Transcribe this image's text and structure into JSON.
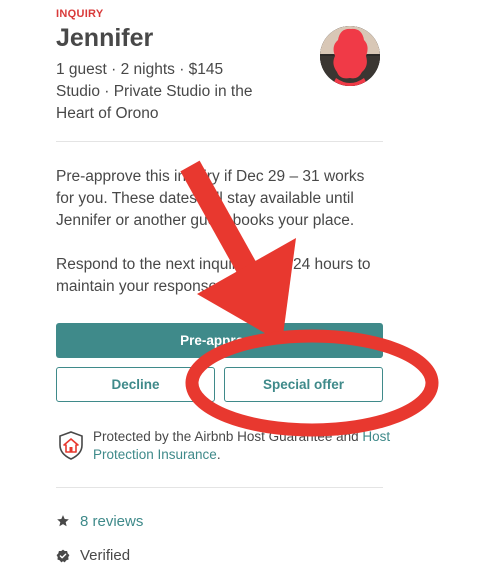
{
  "header": {
    "status_label": "INQUIRY",
    "guest_name": "Jennifer",
    "trip_summary": "1 guest · 2 nights · $145",
    "listing_line1": "Studio · Private Studio in the",
    "listing_line2": "Heart of Orono"
  },
  "message": {
    "paragraph1": "Pre-approve this inquiry if Dec 29 – 31 works for you. These dates will stay available until Jennifer or another guest books your place.",
    "paragraph2": "Respond to the next inquiry within 24 hours to maintain your response rate."
  },
  "actions": {
    "preapprove_label": "Pre-approve",
    "decline_label": "Decline",
    "special_offer_label": "Special offer"
  },
  "protection": {
    "text": "Protected by the Airbnb Host Guarantee and ",
    "link_text": "Host Protection Insurance",
    "suffix": "."
  },
  "profile": {
    "reviews_text": "8 reviews",
    "verified_text": "Verified"
  },
  "icons": {
    "shield": "shield-house-icon",
    "star": "star-icon",
    "verified": "verified-badge-icon"
  },
  "colors": {
    "accent": "#3f8a8a",
    "inquiry_red": "#d93a3a",
    "annotation_red": "#e8382f",
    "text": "#484848"
  }
}
